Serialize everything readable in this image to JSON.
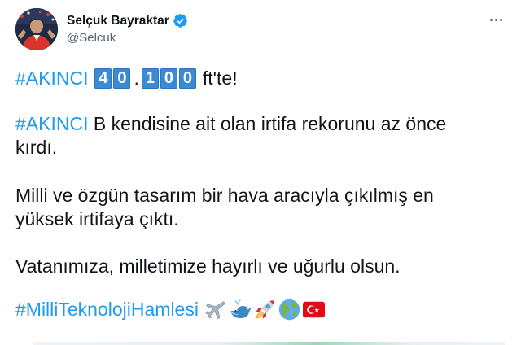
{
  "tweet": {
    "author": {
      "name": "Selçuk Bayraktar",
      "handle": "@Selcuk",
      "verified": true
    },
    "line1": {
      "hashtag": "#AKINCI",
      "digits_a": [
        "4",
        "0"
      ],
      "separator": ".",
      "digits_b": [
        "1",
        "0",
        "0"
      ],
      "tail": "ft'te!"
    },
    "line2": {
      "hashtag": "#AKINCI",
      "text_a": " B kendisine ait olan irtifa rekorunu az önce",
      "text_b": "kırdı."
    },
    "line3": {
      "text_a": "Milli ve özgün tasarım bir hava aracıyla çıkılmış en",
      "text_b": "yüksek irtifaya çıktı."
    },
    "line4": {
      "text": "Vatanımıza, milletimize hayırlı ve uğurlu olsun."
    },
    "line5": {
      "hashtag": "#MilliTeknolojiHamlesi",
      "emojis": [
        "airplane-icon",
        "whale-icon",
        "rocket-icon",
        "globe-icon",
        "turkey-flag-icon"
      ]
    }
  },
  "colors": {
    "link": "#1d9bf0",
    "keycap": "#3a8ad6",
    "secondary": "#536471",
    "verified": "#1d9bf0"
  }
}
